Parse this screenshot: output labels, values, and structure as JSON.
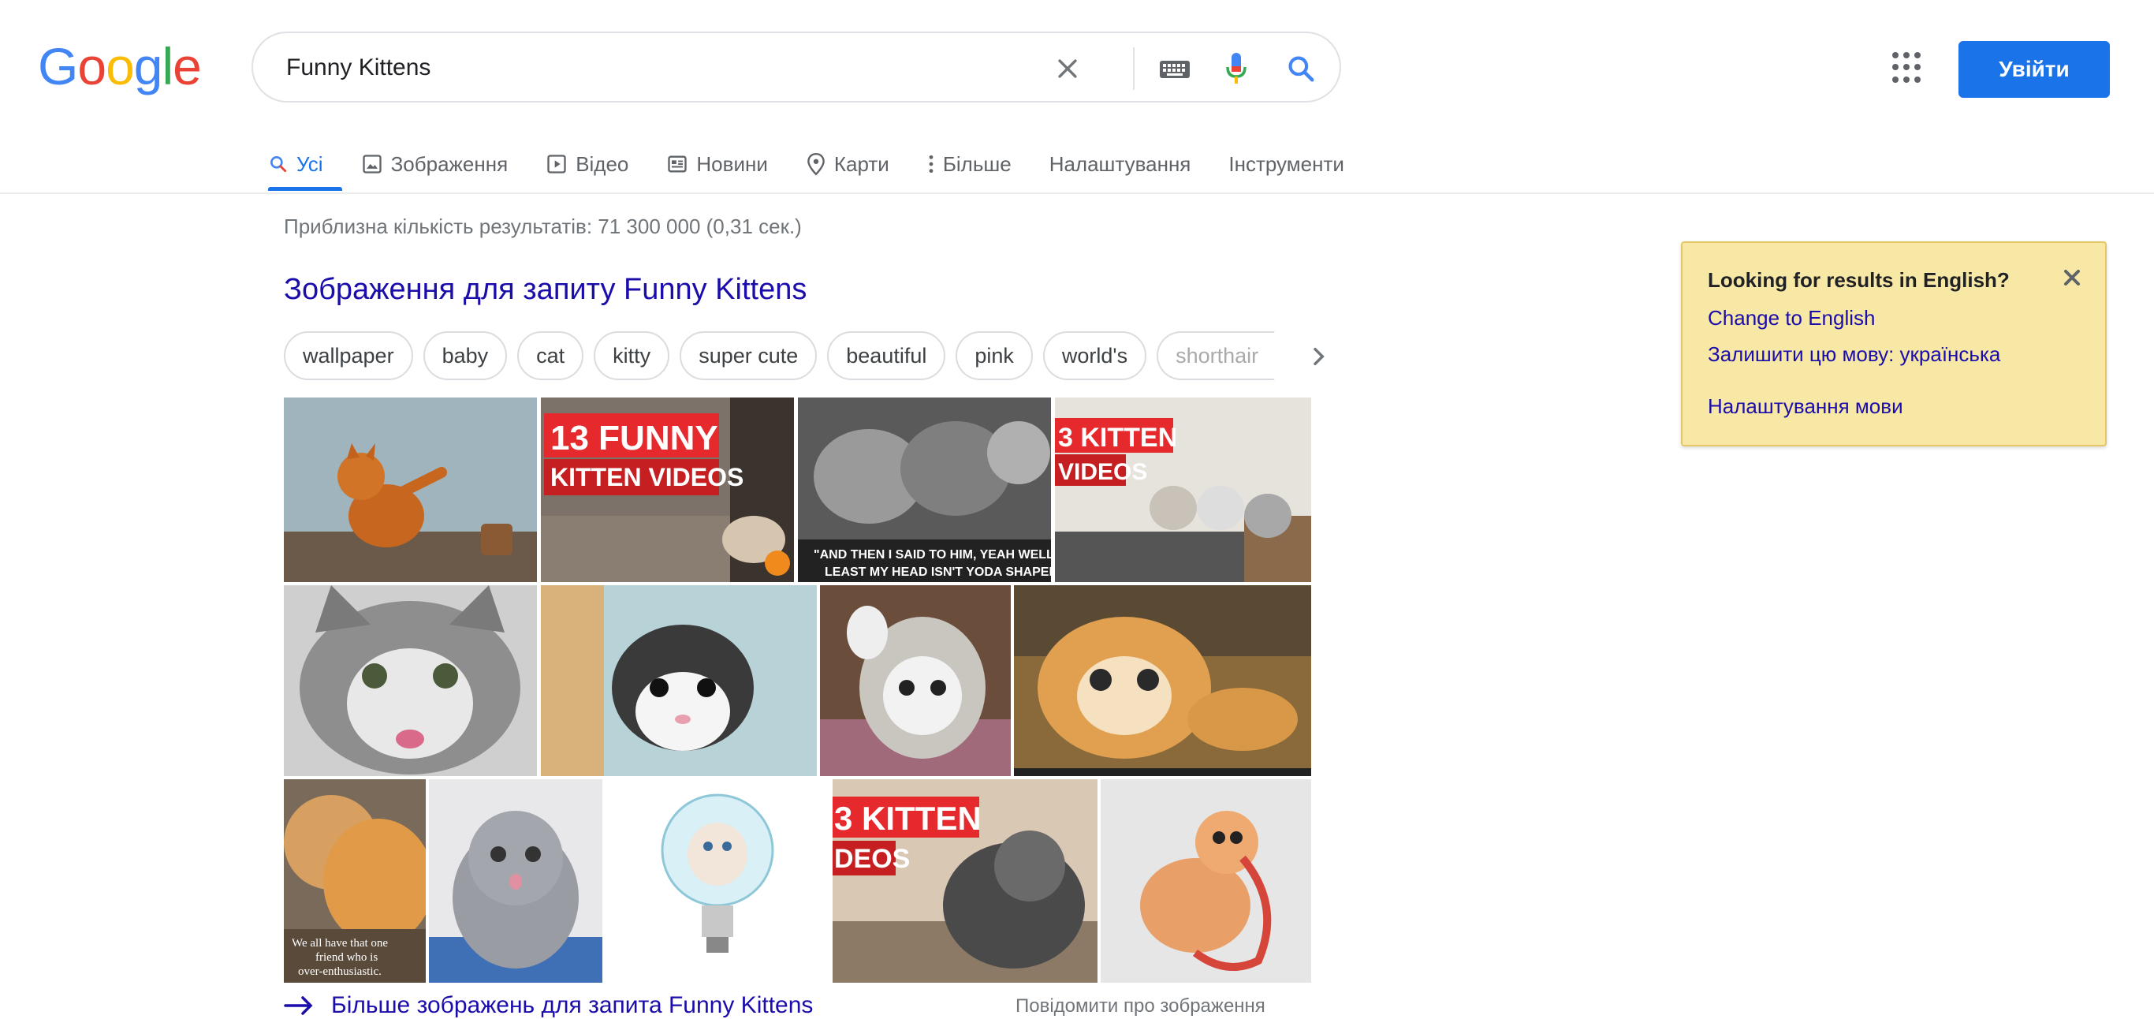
{
  "logo": {
    "letters": [
      "G",
      "o",
      "o",
      "g",
      "l",
      "e"
    ],
    "colors": [
      "#4285f4",
      "#ea4335",
      "#fbbc05",
      "#4285f4",
      "#34a853",
      "#ea4335"
    ]
  },
  "search": {
    "value": "Funny Kittens",
    "icons": [
      "clear-icon",
      "keyboard-icon",
      "mic-icon",
      "search-icon"
    ]
  },
  "header": {
    "signin_label": "Увійти",
    "apps_icon": "apps-grid-icon"
  },
  "tabs": [
    {
      "label": "Усі",
      "icon": "search-icon",
      "active": true
    },
    {
      "label": "Зображення",
      "icon": "image-icon"
    },
    {
      "label": "Відео",
      "icon": "video-icon"
    },
    {
      "label": "Новини",
      "icon": "news-icon"
    },
    {
      "label": "Карти",
      "icon": "map-pin-icon"
    },
    {
      "label": "Більше",
      "icon": "more-vert-icon"
    },
    {
      "label": "Налаштування"
    },
    {
      "label": "Інструменти"
    }
  ],
  "results": {
    "stats": "Приблизна кількість результатів: 71 300 000 (0,31 сек.)"
  },
  "images": {
    "title": "Зображення для запиту Funny Kittens",
    "chips": [
      "wallpaper",
      "baby",
      "cat",
      "kitty",
      "super cute",
      "beautiful",
      "pink",
      "world's",
      "shorthair"
    ],
    "thumb_captions": {
      "t2_line1": "13 FUNNY",
      "t2_line2": "KITTEN VIDEOS",
      "t3_line1": "\"AND THEN I SAID TO HIM, YEAH WELL,",
      "t3_line2": "LEAST MY HEAD ISN'T YODA SHAPED\"",
      "t4_line1": "3 KITTEN",
      "t4_line2": "VIDEOS",
      "t12_line1": "We all have that one",
      "t12_line2": "friend who is",
      "t12_line3": "over-enthusiastic.",
      "t15_line1": "3 KITTEN",
      "t15_line2": "DEOS"
    },
    "more_link": "Більше зображень для запита Funny Kittens",
    "report": "Повідомити про зображення"
  },
  "language_box": {
    "question": "Looking for results in English?",
    "change": "Change to English",
    "keep": "Залишити цю мову: українська",
    "settings": "Налаштування мови"
  },
  "colors": {
    "accent": "#1a73e8",
    "link": "#1a0dab",
    "tip_bg": "#f8e8a6"
  }
}
